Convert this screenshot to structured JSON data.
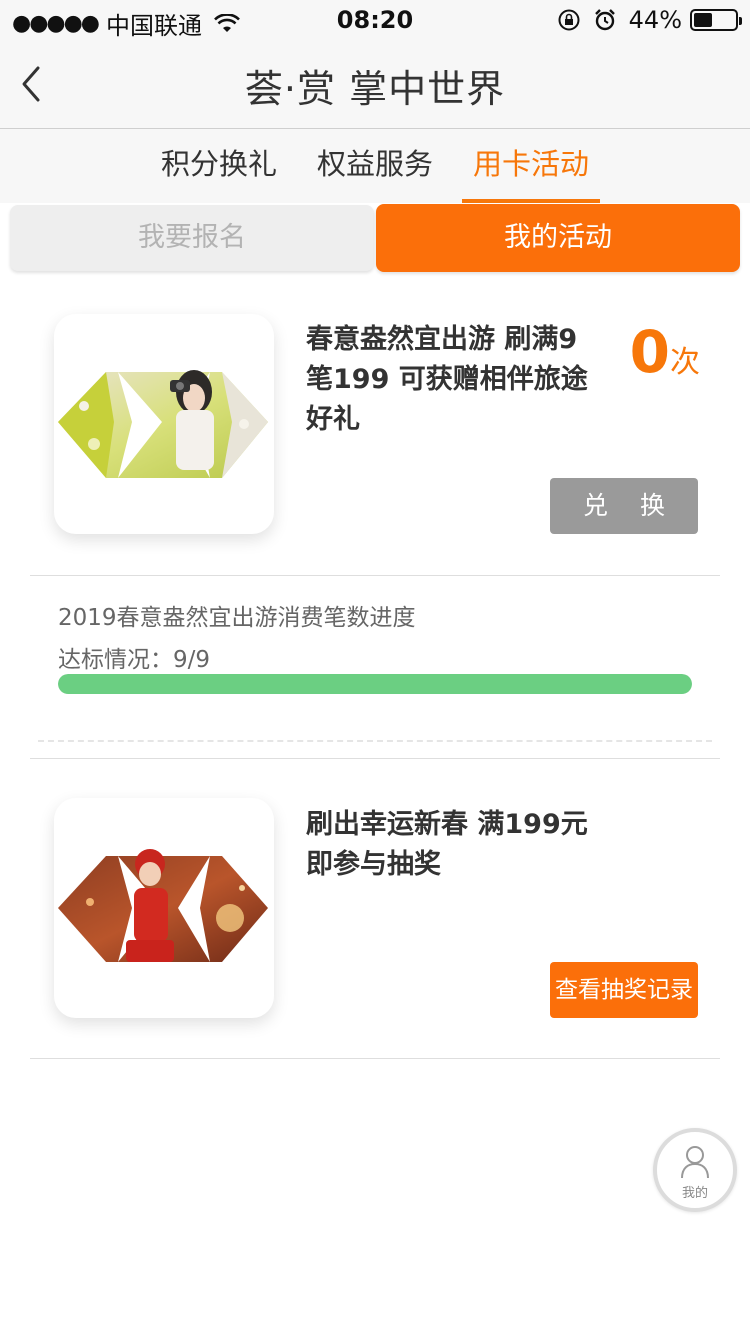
{
  "status_bar": {
    "signal": "●●●●●",
    "carrier": "中国联通",
    "time": "08:20",
    "battery_percent": "44%",
    "battery_level": 0.44,
    "icons": [
      "wifi-icon",
      "rotation-lock-icon",
      "alarm-icon",
      "battery-icon"
    ]
  },
  "nav": {
    "title": "荟·赏 掌中世界",
    "back_icon": "chevron-left-icon"
  },
  "tabs": [
    {
      "label": "积分换礼",
      "active": false
    },
    {
      "label": "权益服务",
      "active": false
    },
    {
      "label": "用卡活动",
      "active": true
    }
  ],
  "segment": {
    "left_label": "我要报名",
    "right_label": "我的活动",
    "selected": "right"
  },
  "activities": [
    {
      "title": "春意盎然宜出游 刷满9笔199 可获赠相伴旅途好礼",
      "count_value": "0",
      "count_unit": "次",
      "button_label": "兑 换",
      "progress_title": "2019春意盎然宜出游消费笔数进度",
      "progress_status": "达标情况：9/9",
      "progress_fraction": 1.0
    },
    {
      "title": "刷出幸运新春 满199元即参与抽奖",
      "button_label": "查看抽奖记录"
    }
  ],
  "floating": {
    "label": "我的",
    "icon": "user-icon"
  },
  "colors": {
    "accent": "#fb6f0a",
    "disabled_button": "#9a9a9a",
    "progress": "#6bcf82"
  }
}
